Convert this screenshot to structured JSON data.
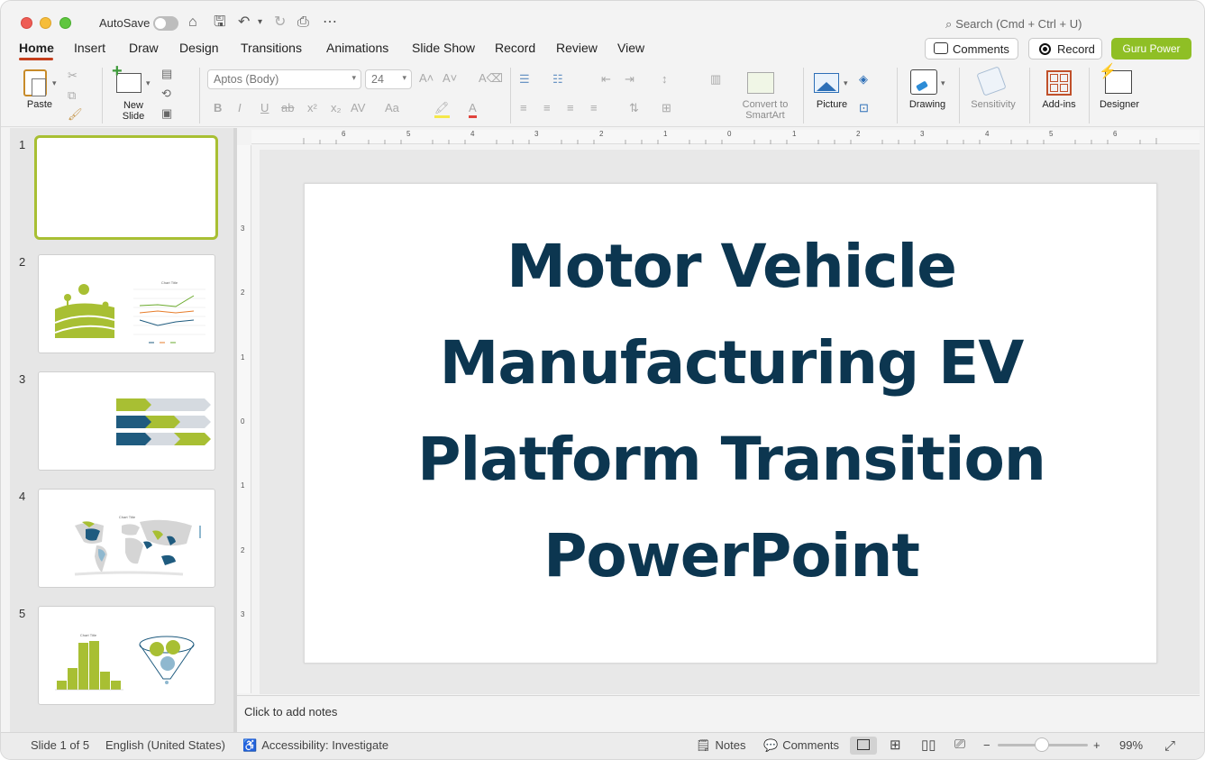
{
  "titlebar": {
    "autosave_label": "AutoSave",
    "search_placeholder": "Search (Cmd + Ctrl + U)"
  },
  "tabs": [
    "Home",
    "Insert",
    "Draw",
    "Design",
    "Transitions",
    "Animations",
    "Slide Show",
    "Record",
    "Review",
    "View"
  ],
  "header_buttons": {
    "comments": "Comments",
    "record": "Record",
    "guru": "Guru Power"
  },
  "ribbon": {
    "paste": "Paste",
    "new_slide": "New\nSlide",
    "font_name": "Aptos (Body)",
    "font_size": "24",
    "convert_smartart": "Convert to\nSmartArt",
    "picture": "Picture",
    "drawing": "Drawing",
    "sensitivity": "Sensitivity",
    "add_ins": "Add-ins",
    "designer": "Designer",
    "format_buttons": [
      "B",
      "I",
      "U",
      "ab",
      "x²",
      "x₂",
      "AV",
      "Aa"
    ]
  },
  "thumbnails": [
    {
      "num": "1"
    },
    {
      "num": "2",
      "chart_title": "Chart Title"
    },
    {
      "num": "3"
    },
    {
      "num": "4",
      "chart_title": "Chart Title"
    },
    {
      "num": "5",
      "chart_title": "Chart Title"
    }
  ],
  "ruler": {
    "h_numbers": [
      "6",
      "5",
      "4",
      "3",
      "2",
      "1",
      "0",
      "1",
      "2",
      "3",
      "4",
      "5",
      "6"
    ],
    "v_numbers": [
      "3",
      "2",
      "1",
      "0",
      "1",
      "2",
      "3"
    ]
  },
  "slide": {
    "title_lines": [
      "Motor Vehicle",
      "Manufacturing EV",
      "Platform Transition",
      "PowerPoint"
    ]
  },
  "notes_placeholder": "Click to add notes",
  "status": {
    "slide_of": "Slide 1 of 5",
    "language": "English (United States)",
    "accessibility": "Accessibility: Investigate",
    "notes": "Notes",
    "comments": "Comments",
    "zoom": "99%"
  },
  "colors": {
    "title": "#0c3650",
    "accent_green": "#a8bf33",
    "accent_navy": "#1f5b7f",
    "tab_underline": "#c43e1c"
  }
}
